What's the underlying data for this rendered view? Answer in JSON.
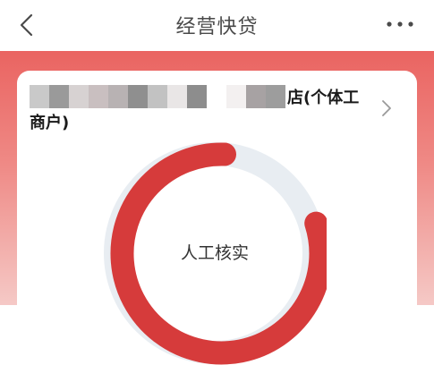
{
  "header": {
    "title": "经营快贷",
    "back_icon": "back-arrow-icon",
    "more_icon": "more-dots-icon"
  },
  "colors": {
    "brand": "#d63b3b",
    "ring_track": "#e8edf2",
    "hero_top": "#ea6461"
  },
  "merchant": {
    "name_tail": "店(个体工",
    "name_line2": "商户)",
    "chevron_icon": "chevron-right-icon"
  },
  "progress": {
    "status_label": "人工核实",
    "ring": "progress-ring"
  }
}
